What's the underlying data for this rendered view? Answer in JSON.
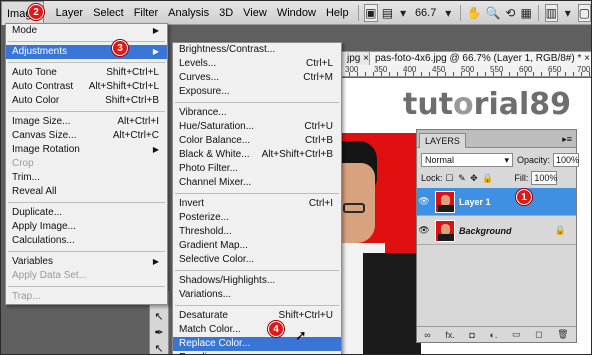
{
  "menubar": {
    "items": [
      "Image",
      "Layer",
      "Select",
      "Filter",
      "Analysis",
      "3D",
      "View",
      "Window",
      "Help"
    ],
    "zoom": "66.7",
    "zoom_arrow": "▾"
  },
  "badges": [
    "1",
    "2",
    "3",
    "4"
  ],
  "document": {
    "tab_left_prefix": "jpg",
    "tab_title": "pas-foto-4x6.jpg @ 66.7% (Layer 1, RGB/8#) *",
    "tab_close": "×",
    "ruler": [
      "300",
      "350",
      "400",
      "450",
      "500",
      "550",
      "600",
      "650",
      "700"
    ]
  },
  "watermark": {
    "left": "tut",
    "mark": "o",
    "right": "rial89"
  },
  "image_menu": {
    "items": [
      {
        "label": "Mode",
        "shortcut": "",
        "submenu": true,
        "disabled": false,
        "highlighted": false
      },
      {
        "sep": true
      },
      {
        "label": "Adjustments",
        "shortcut": "",
        "submenu": true,
        "disabled": false,
        "highlighted": true
      },
      {
        "sep": true
      },
      {
        "label": "Auto Tone",
        "shortcut": "Shift+Ctrl+L",
        "submenu": false,
        "disabled": false,
        "highlighted": false
      },
      {
        "label": "Auto Contrast",
        "shortcut": "Alt+Shift+Ctrl+L",
        "submenu": false,
        "disabled": false,
        "highlighted": false
      },
      {
        "label": "Auto Color",
        "shortcut": "Shift+Ctrl+B",
        "submenu": false,
        "disabled": false,
        "highlighted": false
      },
      {
        "sep": true
      },
      {
        "label": "Image Size...",
        "shortcut": "Alt+Ctrl+I",
        "submenu": false,
        "disabled": false,
        "highlighted": false
      },
      {
        "label": "Canvas Size...",
        "shortcut": "Alt+Ctrl+C",
        "submenu": false,
        "disabled": false,
        "highlighted": false
      },
      {
        "label": "Image Rotation",
        "shortcut": "",
        "submenu": true,
        "disabled": false,
        "highlighted": false
      },
      {
        "label": "Crop",
        "shortcut": "",
        "submenu": false,
        "disabled": true,
        "highlighted": false
      },
      {
        "label": "Trim...",
        "shortcut": "",
        "submenu": false,
        "disabled": false,
        "highlighted": false
      },
      {
        "label": "Reveal All",
        "shortcut": "",
        "submenu": false,
        "disabled": false,
        "highlighted": false
      },
      {
        "sep": true
      },
      {
        "label": "Duplicate...",
        "shortcut": "",
        "submenu": false,
        "disabled": false,
        "highlighted": false
      },
      {
        "label": "Apply Image...",
        "shortcut": "",
        "submenu": false,
        "disabled": false,
        "highlighted": false
      },
      {
        "label": "Calculations...",
        "shortcut": "",
        "submenu": false,
        "disabled": false,
        "highlighted": false
      },
      {
        "sep": true
      },
      {
        "label": "Variables",
        "shortcut": "",
        "submenu": true,
        "disabled": false,
        "highlighted": false
      },
      {
        "label": "Apply Data Set...",
        "shortcut": "",
        "submenu": false,
        "disabled": true,
        "highlighted": false
      },
      {
        "sep": true
      },
      {
        "label": "Trap...",
        "shortcut": "",
        "submenu": false,
        "disabled": true,
        "highlighted": false
      }
    ]
  },
  "adjustments_menu": {
    "items": [
      {
        "label": "Brightness/Contrast...",
        "shortcut": "",
        "highlighted": false
      },
      {
        "label": "Levels...",
        "shortcut": "Ctrl+L",
        "highlighted": false
      },
      {
        "label": "Curves...",
        "shortcut": "Ctrl+M",
        "highlighted": false
      },
      {
        "label": "Exposure...",
        "shortcut": "",
        "highlighted": false
      },
      {
        "sep": true
      },
      {
        "label": "Vibrance...",
        "shortcut": "",
        "highlighted": false
      },
      {
        "label": "Hue/Saturation...",
        "shortcut": "Ctrl+U",
        "highlighted": false
      },
      {
        "label": "Color Balance...",
        "shortcut": "Ctrl+B",
        "highlighted": false
      },
      {
        "label": "Black & White...",
        "shortcut": "Alt+Shift+Ctrl+B",
        "highlighted": false
      },
      {
        "label": "Photo Filter...",
        "shortcut": "",
        "highlighted": false
      },
      {
        "label": "Channel Mixer...",
        "shortcut": "",
        "highlighted": false
      },
      {
        "sep": true
      },
      {
        "label": "Invert",
        "shortcut": "Ctrl+I",
        "highlighted": false
      },
      {
        "label": "Posterize...",
        "shortcut": "",
        "highlighted": false
      },
      {
        "label": "Threshold...",
        "shortcut": "",
        "highlighted": false
      },
      {
        "label": "Gradient Map...",
        "shortcut": "",
        "highlighted": false
      },
      {
        "label": "Selective Color...",
        "shortcut": "",
        "highlighted": false
      },
      {
        "sep": true
      },
      {
        "label": "Shadows/Highlights...",
        "shortcut": "",
        "highlighted": false
      },
      {
        "label": "Variations...",
        "shortcut": "",
        "highlighted": false
      },
      {
        "sep": true
      },
      {
        "label": "Desaturate",
        "shortcut": "Shift+Ctrl+U",
        "highlighted": false
      },
      {
        "label": "Match Color...",
        "shortcut": "",
        "highlighted": false
      },
      {
        "label": "Replace Color...",
        "shortcut": "",
        "highlighted": true
      },
      {
        "label": "Equalize",
        "shortcut": "",
        "highlighted": false
      }
    ]
  },
  "layers_panel": {
    "tab": "LAYERS",
    "menu": "▸≡",
    "blend_mode": "Normal",
    "blend_arrow": "▾",
    "opacity_label": "Opacity:",
    "opacity": "100%",
    "lock_label": "Lock:",
    "lock_icons": "☐ ✎ ✥ 🔒",
    "fill_label": "Fill:",
    "fill": "100%",
    "layers": [
      {
        "name": "Layer 1",
        "selected": true,
        "italic": false,
        "locked": false
      },
      {
        "name": "Background",
        "selected": false,
        "italic": true,
        "locked": true
      }
    ],
    "footer_icons": [
      "∞",
      "fx.",
      "◘",
      "◐.",
      "▭",
      "◻",
      "🗑"
    ]
  },
  "colors": {
    "highlight": "#3875d7",
    "badge": "#e01818",
    "photo_bg": "#e01010"
  }
}
